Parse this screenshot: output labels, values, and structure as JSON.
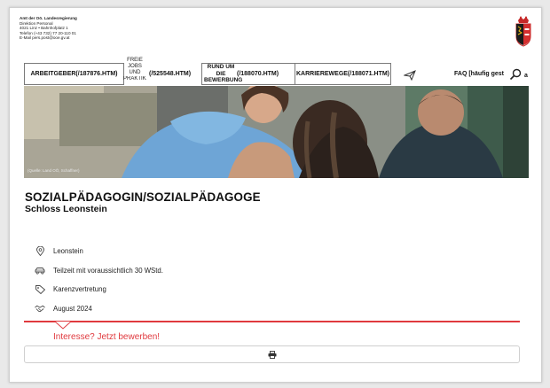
{
  "address": {
    "line1": "Amt der Oö. Landesregierung",
    "line2": "Direktion Personal",
    "line3": "4021 Linz • Bahnhofplatz 1",
    "line4": "Telefon (+43 732) 77 20-110 01",
    "line5": "E-Mail pers.post@ooe.gv.at"
  },
  "nav": {
    "arbeitgeber": "ARBEITGEBER(/187876.HTM)",
    "freie_jobs": [
      "FREIE",
      "JOBS",
      "UND",
      "PRAKTIKA"
    ],
    "freie_jobs_link": "(/525548.HTM)",
    "bewerbung": [
      "RUND UM",
      "DIE",
      "BEWERBUNG"
    ],
    "bewerbung_link": "(/188070.HTM)",
    "karrierewege": "KARRIEREWEGE(/188071.HTM)",
    "faq": "FAQ [häufig gest"
  },
  "hero": {
    "caption": "(Quelle: Land OÖ, Schaffner)"
  },
  "job": {
    "title": "SOZIALPÄDAGOGIN/SOZIALPÄDAGOGE",
    "subtitle": "Schloss Leonstein",
    "facts": [
      {
        "icon": "location-pin-icon",
        "text": "Leonstein"
      },
      {
        "icon": "car-icon",
        "text": "Teilzeit mit voraussichtlich 30 WStd."
      },
      {
        "icon": "tag-icon",
        "text": "Karenzvertretung"
      },
      {
        "icon": "handshake-icon",
        "text": "August 2024"
      }
    ]
  },
  "apply": {
    "label": "Interesse? Jetzt bewerben!"
  },
  "colors": {
    "accent_red": "#e0393e",
    "text": "#111111"
  }
}
